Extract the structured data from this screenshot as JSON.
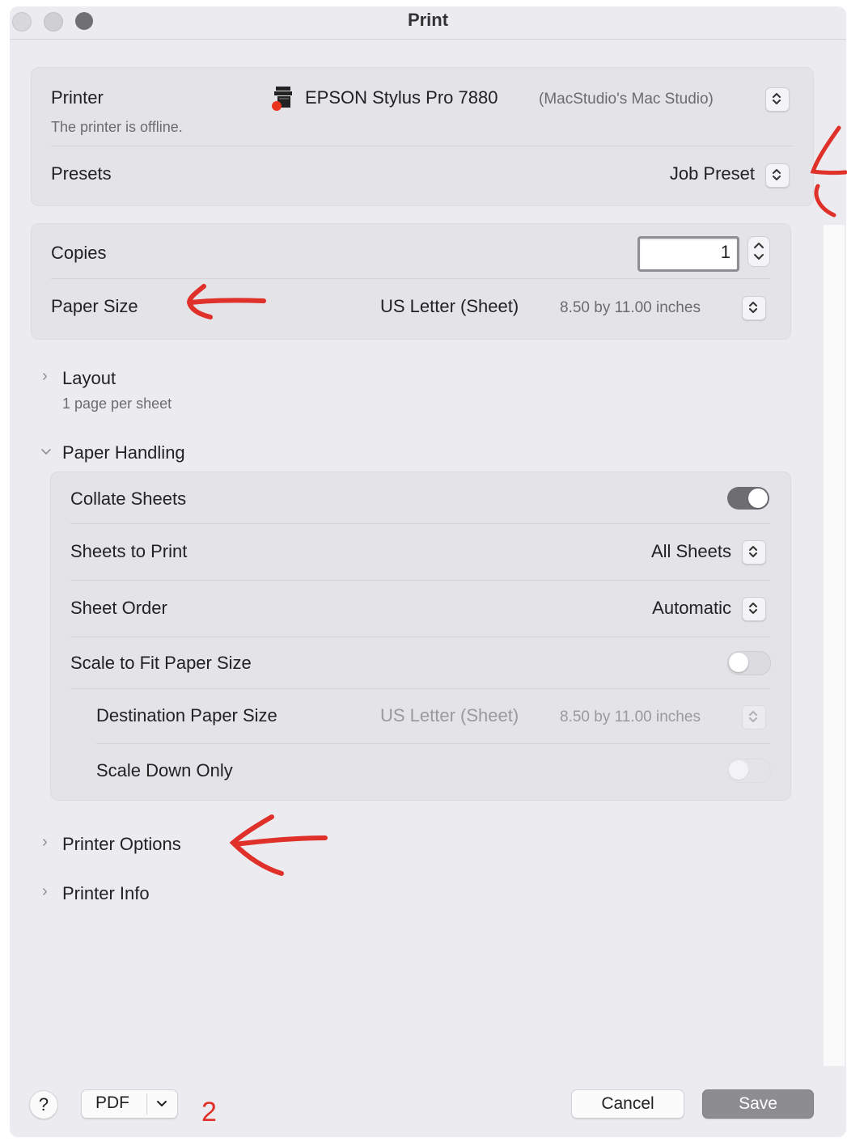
{
  "window": {
    "title": "Print"
  },
  "printer_card": {
    "printer_label": "Printer",
    "printer_status": "The printer is offline.",
    "printer_name": "EPSON Stylus Pro 7880",
    "printer_host": "(MacStudio's Mac Studio)",
    "presets_label": "Presets",
    "presets_value": "Job Preset"
  },
  "copies_card": {
    "copies_label": "Copies",
    "copies_value": "1",
    "paper_size_label": "Paper Size",
    "paper_size_value": "US Letter (Sheet)",
    "paper_size_dims": "8.50 by 11.00 inches"
  },
  "layout_section": {
    "title": "Layout",
    "summary": "1 page per sheet",
    "expanded": false
  },
  "paper_handling": {
    "title": "Paper Handling",
    "expanded": true,
    "collate_label": "Collate Sheets",
    "collate_on": true,
    "sheets_to_print_label": "Sheets to Print",
    "sheets_to_print_value": "All Sheets",
    "sheet_order_label": "Sheet Order",
    "sheet_order_value": "Automatic",
    "scale_to_fit_label": "Scale to Fit Paper Size",
    "scale_to_fit_on": false,
    "destination_label": "Destination Paper Size",
    "destination_value": "US Letter (Sheet)",
    "destination_dims": "8.50 by 11.00 inches",
    "scale_down_label": "Scale Down Only",
    "scale_down_on": false
  },
  "printer_options_section": {
    "title": "Printer Options",
    "expanded": false
  },
  "printer_info_section": {
    "title": "Printer Info",
    "expanded": false
  },
  "footer": {
    "help_label": "?",
    "pdf_label": "PDF",
    "cancel_label": "Cancel",
    "save_label": "Save"
  },
  "annotation": {
    "number": "2",
    "color": "#e0302a"
  },
  "icons": {
    "printer": "printer-icon",
    "updown": "updown-chevron-icon",
    "disclosure_right": "chevron-right-icon",
    "disclosure_down": "chevron-down-icon",
    "dropdown": "chevron-down-icon"
  },
  "colors": {
    "window_bg": "#ecebef",
    "card_bg": "#e4e3e7",
    "toggle_on": "#6e6e72",
    "primary_button": "#8d8d91"
  }
}
